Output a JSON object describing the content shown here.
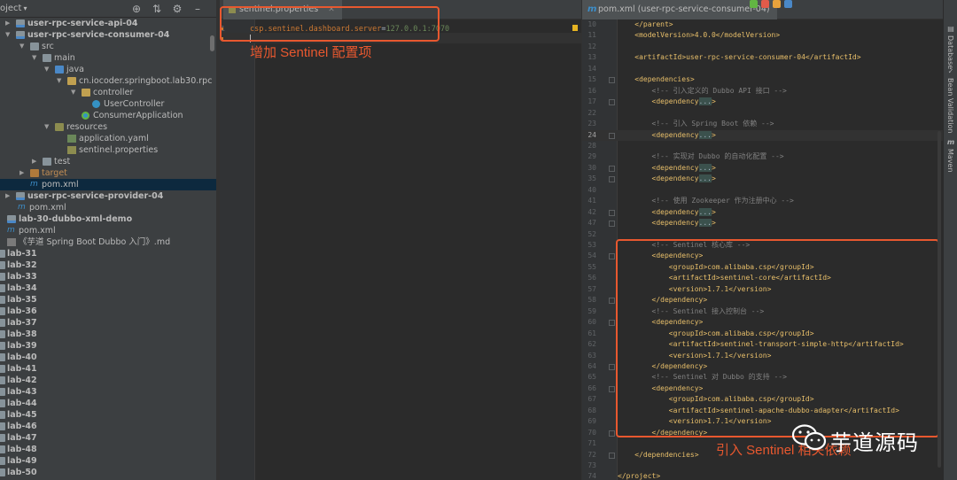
{
  "project_panel": {
    "title": "oject",
    "tree": [
      {
        "label": "user-rpc-service-api-04",
        "bold": true
      },
      {
        "label": "user-rpc-service-consumer-04",
        "bold": true
      },
      {
        "label": "src"
      },
      {
        "label": "main"
      },
      {
        "label": "java"
      },
      {
        "label": "cn.iocoder.springboot.lab30.rpc"
      },
      {
        "label": "controller"
      },
      {
        "label": "UserController"
      },
      {
        "label": "ConsumerApplication"
      },
      {
        "label": "resources"
      },
      {
        "label": "application.yaml"
      },
      {
        "label": "sentinel.properties"
      },
      {
        "label": "test"
      },
      {
        "label": "target"
      },
      {
        "label": "pom.xml"
      },
      {
        "label": "user-rpc-service-provider-04",
        "bold": true
      },
      {
        "label": "pom.xml"
      },
      {
        "label": "lab-30-dubbo-xml-demo",
        "bold": true
      },
      {
        "label": "pom.xml"
      },
      {
        "label": "《芋道 Spring Boot Dubbo 入门》.md"
      }
    ],
    "labs": [
      "lab-31",
      "lab-32",
      "lab-33",
      "lab-34",
      "lab-35",
      "lab-36",
      "lab-37",
      "lab-38",
      "lab-39",
      "lab-40",
      "lab-41",
      "lab-42",
      "lab-43",
      "lab-44",
      "lab-45",
      "lab-46",
      "lab-47",
      "lab-48",
      "lab-49",
      "lab-50"
    ]
  },
  "left_editor": {
    "tab_label": "sentinel.properties",
    "line_numbers": [
      "1",
      "2"
    ],
    "line1_key": "csp.sentinel.dashboard.server",
    "line1_eq": "=",
    "line1_value": "127.0.0.1:7070",
    "annotation": "增加 Sentinel 配置项"
  },
  "right_editor": {
    "tab_label": "pom.xml (user-rpc-service-consumer-04)",
    "lines": [
      {
        "n": "10",
        "t": "    </parent>"
      },
      {
        "n": "11",
        "t": "    <modelVersion>4.0.0</modelVersion>"
      },
      {
        "n": "12",
        "t": ""
      },
      {
        "n": "13",
        "t": "    <artifactId>user-rpc-service-consumer-04</artifactId>"
      },
      {
        "n": "14",
        "t": ""
      },
      {
        "n": "15",
        "t": "    <dependencies>"
      },
      {
        "n": "16",
        "t": "        <!-- 引入定义的 Dubbo API 接口 -->",
        "c": true
      },
      {
        "n": "17",
        "t": "        <dependency...>",
        "f": true
      },
      {
        "n": "22",
        "t": ""
      },
      {
        "n": "23",
        "t": "        <!-- 引入 Spring Boot 依赖 -->",
        "c": true
      },
      {
        "n": "24",
        "t": "        <dependency...>",
        "f": true,
        "cur": true
      },
      {
        "n": "28",
        "t": ""
      },
      {
        "n": "29",
        "t": "        <!-- 实现对 Dubbo 的自动化配置 -->",
        "c": true
      },
      {
        "n": "30",
        "t": "        <dependency...>",
        "f": true
      },
      {
        "n": "35",
        "t": "        <dependency...>",
        "f": true
      },
      {
        "n": "40",
        "t": ""
      },
      {
        "n": "41",
        "t": "        <!-- 使用 Zookeeper 作为注册中心 -->",
        "c": true
      },
      {
        "n": "42",
        "t": "        <dependency...>",
        "f": true
      },
      {
        "n": "47",
        "t": "        <dependency...>",
        "f": true
      },
      {
        "n": "52",
        "t": ""
      },
      {
        "n": "53",
        "t": "        <!-- Sentinel 核心库 -->",
        "c": true
      },
      {
        "n": "54",
        "t": "        <dependency>"
      },
      {
        "n": "55",
        "t": "            <groupId>com.alibaba.csp</groupId>"
      },
      {
        "n": "56",
        "t": "            <artifactId>sentinel-core</artifactId>"
      },
      {
        "n": "57",
        "t": "            <version>1.7.1</version>"
      },
      {
        "n": "58",
        "t": "        </dependency>"
      },
      {
        "n": "59",
        "t": "        <!-- Sentinel 接入控制台 -->",
        "c": true
      },
      {
        "n": "60",
        "t": "        <dependency>"
      },
      {
        "n": "61",
        "t": "            <groupId>com.alibaba.csp</groupId>"
      },
      {
        "n": "62",
        "t": "            <artifactId>sentinel-transport-simple-http</artifactId>"
      },
      {
        "n": "63",
        "t": "            <version>1.7.1</version>"
      },
      {
        "n": "64",
        "t": "        </dependency>"
      },
      {
        "n": "65",
        "t": "        <!-- Sentinel 对 Dubbo 的支持 -->",
        "c": true
      },
      {
        "n": "66",
        "t": "        <dependency>"
      },
      {
        "n": "67",
        "t": "            <groupId>com.alibaba.csp</groupId>"
      },
      {
        "n": "68",
        "t": "            <artifactId>sentinel-apache-dubbo-adapter</artifactId>"
      },
      {
        "n": "69",
        "t": "            <version>1.7.1</version>"
      },
      {
        "n": "70",
        "t": "        </dependency>"
      },
      {
        "n": "71",
        "t": ""
      },
      {
        "n": "72",
        "t": "    </dependencies>"
      },
      {
        "n": "73",
        "t": ""
      },
      {
        "n": "74",
        "t": "</project>"
      }
    ],
    "annotation": "引入 Sentinel 相关依赖"
  },
  "tool_strip": {
    "database": "Database",
    "bean_validation": "Bean Validation",
    "maven": "Maven"
  },
  "watermark": "芋道源码",
  "colors": {
    "annotation": "#e8582f",
    "tag": "#e8bf6a",
    "comment": "#808080",
    "value": "#6a8759",
    "key": "#cc7832"
  }
}
